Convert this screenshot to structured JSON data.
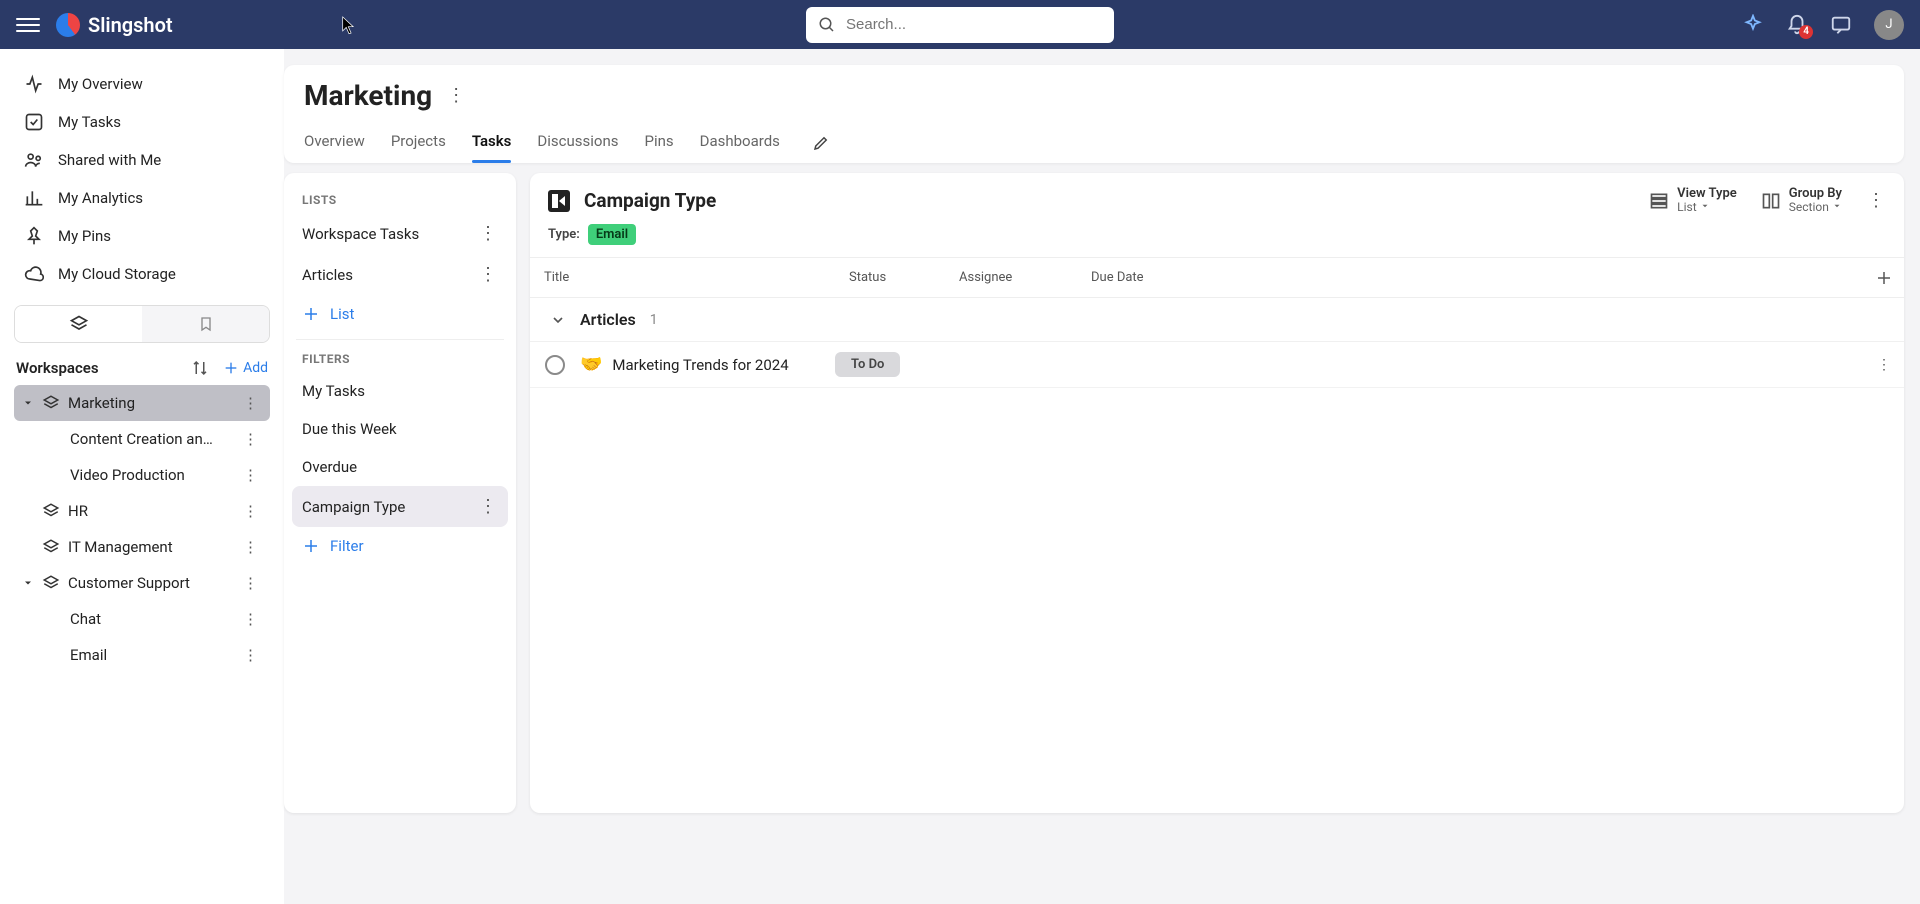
{
  "brand": {
    "name": "Slingshot"
  },
  "search": {
    "placeholder": "Search..."
  },
  "notifications": {
    "count": "4"
  },
  "avatar": {
    "initial": "J"
  },
  "nav": {
    "overview": "My Overview",
    "tasks": "My Tasks",
    "shared": "Shared with Me",
    "analytics": "My Analytics",
    "pins": "My Pins",
    "cloud": "My Cloud Storage"
  },
  "workspaces": {
    "title": "Workspaces",
    "add": "Add",
    "items": [
      {
        "label": "Marketing",
        "children": [
          "Content Creation an…",
          "Video Production"
        ]
      },
      {
        "label": "HR"
      },
      {
        "label": "IT Management"
      },
      {
        "label": "Customer Support",
        "children": [
          "Chat",
          "Email"
        ]
      }
    ]
  },
  "page": {
    "title": "Marketing",
    "tabs": [
      "Overview",
      "Projects",
      "Tasks",
      "Discussions",
      "Pins",
      "Dashboards"
    ],
    "active_tab_index": 2
  },
  "lists_panel": {
    "lists_head": "LISTS",
    "lists": [
      "Workspace Tasks",
      "Articles"
    ],
    "add_list": "List",
    "filters_head": "FILTERS",
    "filters": [
      "My Tasks",
      "Due this Week",
      "Overdue",
      "Campaign Type"
    ],
    "active_filter_index": 3,
    "add_filter": "Filter"
  },
  "tasks_panel": {
    "title": "Campaign Type",
    "type_label": "Type:",
    "type_value": "Email",
    "view_type_label": "View Type",
    "view_type_value": "List",
    "group_by_label": "Group By",
    "group_by_value": "Section",
    "columns": {
      "title": "Title",
      "status": "Status",
      "assignee": "Assignee",
      "due": "Due Date"
    },
    "group": {
      "name": "Articles",
      "count": "1"
    },
    "tasks": [
      {
        "emoji": "🤝",
        "title": "Marketing Trends for 2024",
        "status": "To Do"
      }
    ]
  }
}
